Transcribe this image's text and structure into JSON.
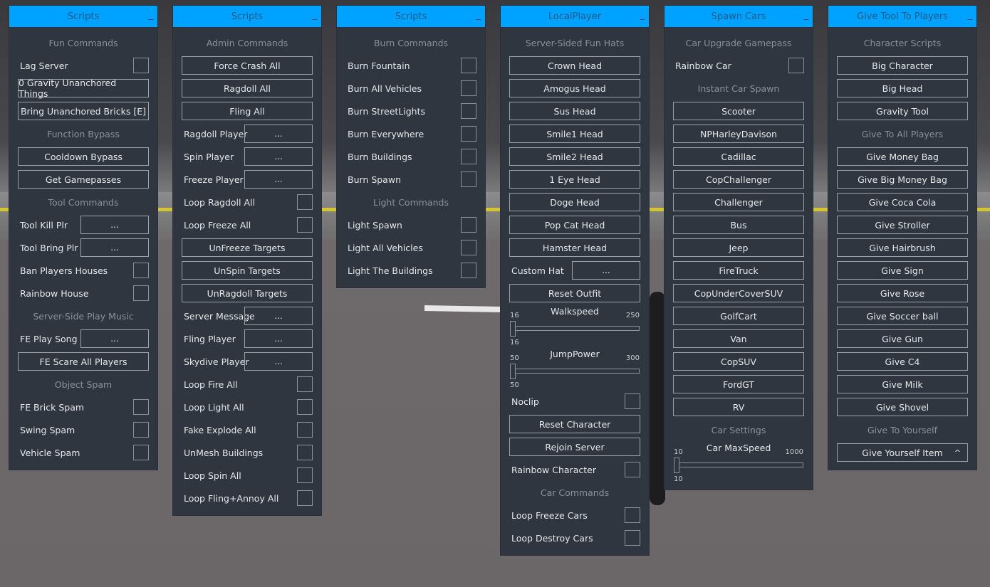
{
  "panels": [
    {
      "title": "Scripts",
      "rows": [
        {
          "type": "section",
          "text": "Fun Commands"
        },
        {
          "type": "toggle",
          "text": "Lag Server"
        },
        {
          "type": "button",
          "text": "0 Gravity Unanchored Things"
        },
        {
          "type": "button",
          "text": "Bring Unanchored Bricks [E]"
        },
        {
          "type": "section",
          "text": "Function Bypass"
        },
        {
          "type": "button",
          "text": "Cooldown Bypass"
        },
        {
          "type": "button",
          "text": "Get Gamepasses"
        },
        {
          "type": "section",
          "text": "Tool Commands"
        },
        {
          "type": "picker",
          "text": "Tool Kill Plr",
          "value": "..."
        },
        {
          "type": "picker",
          "text": "Tool Bring Plr",
          "value": "..."
        },
        {
          "type": "toggle",
          "text": "Ban Players Houses"
        },
        {
          "type": "toggle",
          "text": "Rainbow House"
        },
        {
          "type": "section",
          "text": "Server-Side Play Music"
        },
        {
          "type": "picker",
          "text": "FE Play Song",
          "value": "..."
        },
        {
          "type": "button",
          "text": "FE Scare All Players"
        },
        {
          "type": "section",
          "text": "Object Spam"
        },
        {
          "type": "toggle",
          "text": "FE Brick Spam"
        },
        {
          "type": "toggle",
          "text": "Swing Spam"
        },
        {
          "type": "toggle",
          "text": "Vehicle Spam"
        }
      ]
    },
    {
      "title": "Scripts",
      "rows": [
        {
          "type": "section",
          "text": "Admin Commands"
        },
        {
          "type": "button",
          "text": "Force Crash All"
        },
        {
          "type": "button",
          "text": "Ragdoll All"
        },
        {
          "type": "button",
          "text": "Fling All"
        },
        {
          "type": "picker",
          "text": "Ragdoll Player",
          "value": "..."
        },
        {
          "type": "picker",
          "text": "Spin Player",
          "value": "..."
        },
        {
          "type": "picker",
          "text": "Freeze Player",
          "value": "..."
        },
        {
          "type": "toggle",
          "text": "Loop Ragdoll All"
        },
        {
          "type": "toggle",
          "text": "Loop Freeze All"
        },
        {
          "type": "button",
          "text": "UnFreeze Targets"
        },
        {
          "type": "button",
          "text": "UnSpin Targets"
        },
        {
          "type": "button",
          "text": "UnRagdoll Targets"
        },
        {
          "type": "picker",
          "text": "Server Message",
          "value": "..."
        },
        {
          "type": "picker",
          "text": "Fling Player",
          "value": "..."
        },
        {
          "type": "picker",
          "text": "Skydive Player",
          "value": "..."
        },
        {
          "type": "toggle",
          "text": "Loop Fire All"
        },
        {
          "type": "toggle",
          "text": "Loop Light All"
        },
        {
          "type": "toggle",
          "text": "Fake Explode All"
        },
        {
          "type": "toggle",
          "text": "UnMesh Buildings"
        },
        {
          "type": "toggle",
          "text": "Loop Spin All"
        },
        {
          "type": "toggle",
          "text": "Loop Fling+Annoy All"
        }
      ]
    },
    {
      "title": "Scripts",
      "rows": [
        {
          "type": "section",
          "text": "Burn Commands"
        },
        {
          "type": "toggle",
          "text": "Burn Fountain"
        },
        {
          "type": "toggle",
          "text": "Burn All Vehicles"
        },
        {
          "type": "toggle",
          "text": "Burn StreetLights"
        },
        {
          "type": "toggle",
          "text": "Burn Everywhere"
        },
        {
          "type": "toggle",
          "text": "Burn Buildings"
        },
        {
          "type": "toggle",
          "text": "Burn Spawn"
        },
        {
          "type": "section",
          "text": "Light Commands"
        },
        {
          "type": "toggle",
          "text": "Light Spawn"
        },
        {
          "type": "toggle",
          "text": "Light All Vehicles"
        },
        {
          "type": "toggle",
          "text": "Light The Buildings"
        }
      ]
    },
    {
      "title": "LocalPlayer",
      "rows": [
        {
          "type": "section",
          "text": "Server-Sided Fun Hats"
        },
        {
          "type": "button",
          "text": "Crown Head"
        },
        {
          "type": "button",
          "text": "Amogus Head"
        },
        {
          "type": "button",
          "text": "Sus Head"
        },
        {
          "type": "button",
          "text": "Smile1 Head"
        },
        {
          "type": "button",
          "text": "Smile2 Head"
        },
        {
          "type": "button",
          "text": "1 Eye Head"
        },
        {
          "type": "button",
          "text": "Doge Head"
        },
        {
          "type": "button",
          "text": "Pop Cat Head"
        },
        {
          "type": "button",
          "text": "Hamster Head"
        },
        {
          "type": "picker",
          "text": "Custom Hat",
          "value": "..."
        },
        {
          "type": "button",
          "text": "Reset Outfit"
        },
        {
          "type": "slider",
          "text": "Walkspeed",
          "min": "16",
          "max": "250",
          "value": "16",
          "fraction": 0
        },
        {
          "type": "slider",
          "text": "JumpPower",
          "min": "50",
          "max": "300",
          "value": "50",
          "fraction": 0
        },
        {
          "type": "toggle",
          "text": "Noclip"
        },
        {
          "type": "button",
          "text": "Reset Character"
        },
        {
          "type": "button",
          "text": "Rejoin Server"
        },
        {
          "type": "toggle",
          "text": "Rainbow Character"
        },
        {
          "type": "section",
          "text": "Car Commands"
        },
        {
          "type": "toggle",
          "text": "Loop Freeze Cars"
        },
        {
          "type": "toggle",
          "text": "Loop Destroy Cars"
        }
      ]
    },
    {
      "title": "Spawn Cars",
      "rows": [
        {
          "type": "section",
          "text": "Car Upgrade Gamepass"
        },
        {
          "type": "toggle",
          "text": "Rainbow Car"
        },
        {
          "type": "section",
          "text": "Instant Car Spawn"
        },
        {
          "type": "button",
          "text": "Scooter"
        },
        {
          "type": "button",
          "text": "NPHarleyDavison"
        },
        {
          "type": "button",
          "text": "Cadillac"
        },
        {
          "type": "button",
          "text": "CopChallenger"
        },
        {
          "type": "button",
          "text": "Challenger"
        },
        {
          "type": "button",
          "text": "Bus"
        },
        {
          "type": "button",
          "text": "Jeep"
        },
        {
          "type": "button",
          "text": "FireTruck"
        },
        {
          "type": "button",
          "text": "CopUnderCoverSUV"
        },
        {
          "type": "button",
          "text": "GolfCart"
        },
        {
          "type": "button",
          "text": "Van"
        },
        {
          "type": "button",
          "text": "CopSUV"
        },
        {
          "type": "button",
          "text": "FordGT"
        },
        {
          "type": "button",
          "text": "RV"
        },
        {
          "type": "section",
          "text": "Car Settings"
        },
        {
          "type": "slider",
          "text": "Car MaxSpeed",
          "min": "10",
          "max": "1000",
          "value": "10",
          "fraction": 0
        }
      ]
    },
    {
      "title": "Give Tool To Players",
      "rows": [
        {
          "type": "section",
          "text": "Character Scripts"
        },
        {
          "type": "button",
          "text": "Big Character"
        },
        {
          "type": "button",
          "text": "Big Head"
        },
        {
          "type": "button",
          "text": "Gravity Tool"
        },
        {
          "type": "section",
          "text": "Give To All Players"
        },
        {
          "type": "button",
          "text": "Give Money Bag"
        },
        {
          "type": "button",
          "text": "Give Big Money Bag"
        },
        {
          "type": "button",
          "text": "Give Coca Cola"
        },
        {
          "type": "button",
          "text": "Give Stroller"
        },
        {
          "type": "button",
          "text": "Give Hairbrush"
        },
        {
          "type": "button",
          "text": "Give Sign"
        },
        {
          "type": "button",
          "text": "Give Rose"
        },
        {
          "type": "button",
          "text": "Give Soccer ball"
        },
        {
          "type": "button",
          "text": "Give Gun"
        },
        {
          "type": "button",
          "text": "Give C4"
        },
        {
          "type": "button",
          "text": "Give Milk"
        },
        {
          "type": "button",
          "text": "Give Shovel"
        },
        {
          "type": "section",
          "text": "Give To Yourself"
        },
        {
          "type": "dropdown",
          "text": "Give Yourself Item",
          "icon": "^"
        }
      ]
    }
  ],
  "minimize_glyph": "_",
  "colors": {
    "titlebar": "#00a2ff",
    "panel": "#2f3640"
  }
}
